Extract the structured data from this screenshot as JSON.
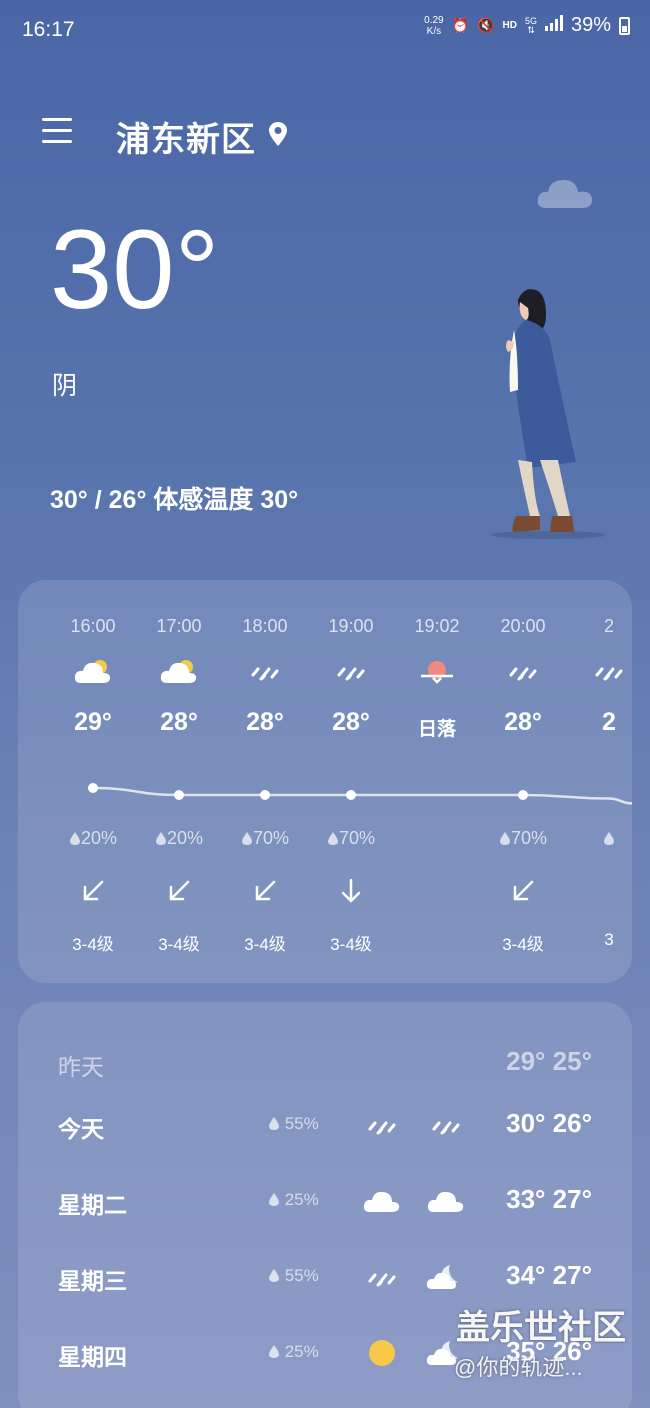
{
  "status_bar": {
    "time": "16:17",
    "net_speed_value": "0.29",
    "net_speed_unit": "K/s",
    "hd": "HD",
    "network": "5G",
    "battery": "39%"
  },
  "header": {
    "location": "浦东新区"
  },
  "current": {
    "temperature": "30°",
    "condition": "阴",
    "range_feels": "30° / 26° 体感温度 30°"
  },
  "hourly": [
    {
      "time": "16:00",
      "icon": "partly-cloudy-icon",
      "temp": "29°",
      "rain": "20%",
      "wind_dir": "down-left",
      "wind_level": "3-4级"
    },
    {
      "time": "17:00",
      "icon": "partly-cloudy-icon",
      "temp": "28°",
      "rain": "20%",
      "wind_dir": "down-left",
      "wind_level": "3-4级"
    },
    {
      "time": "18:00",
      "icon": "rain-icon",
      "temp": "28°",
      "rain": "70%",
      "wind_dir": "down-left",
      "wind_level": "3-4级"
    },
    {
      "time": "19:00",
      "icon": "rain-icon",
      "temp": "28°",
      "rain": "70%",
      "wind_dir": "down",
      "wind_level": "3-4级"
    },
    {
      "time": "19:02",
      "icon": "sunset-icon",
      "temp": "日落",
      "rain": "",
      "wind_dir": "",
      "wind_level": ""
    },
    {
      "time": "20:00",
      "icon": "rain-icon",
      "temp": "28°",
      "rain": "70%",
      "wind_dir": "down-left",
      "wind_level": "3-4级"
    },
    {
      "time": "2",
      "icon": "rain-icon",
      "temp": "2",
      "rain": "",
      "wind_dir": "",
      "wind_level": "3"
    }
  ],
  "hourly_temps_numeric": [
    29,
    28,
    28,
    28,
    null,
    28,
    27.5
  ],
  "daily": [
    {
      "day": "昨天",
      "rain": "",
      "icon_day": "",
      "icon_night": "",
      "temps": "29° 25°",
      "dim": true
    },
    {
      "day": "今天",
      "rain": "55%",
      "icon_day": "rain-icon",
      "icon_night": "rain-icon",
      "temps": "30° 26°",
      "dim": false
    },
    {
      "day": "星期二",
      "rain": "25%",
      "icon_day": "cloud-icon",
      "icon_night": "cloud-icon",
      "temps": "33° 27°",
      "dim": false
    },
    {
      "day": "星期三",
      "rain": "55%",
      "icon_day": "rain-icon",
      "icon_night": "moon-cloud-icon",
      "temps": "34° 27°",
      "dim": false
    },
    {
      "day": "星期四",
      "rain": "25%",
      "icon_day": "sun-icon",
      "icon_night": "moon-cloud-icon",
      "temps": "35° 26°",
      "dim": false
    }
  ],
  "watermark": {
    "line1": "盖乐世社区",
    "line2": "@你的轨迹..."
  },
  "colors": {
    "sun": "#f7c948",
    "sunset": "#f08a7e",
    "cloud": "#ffffff"
  }
}
